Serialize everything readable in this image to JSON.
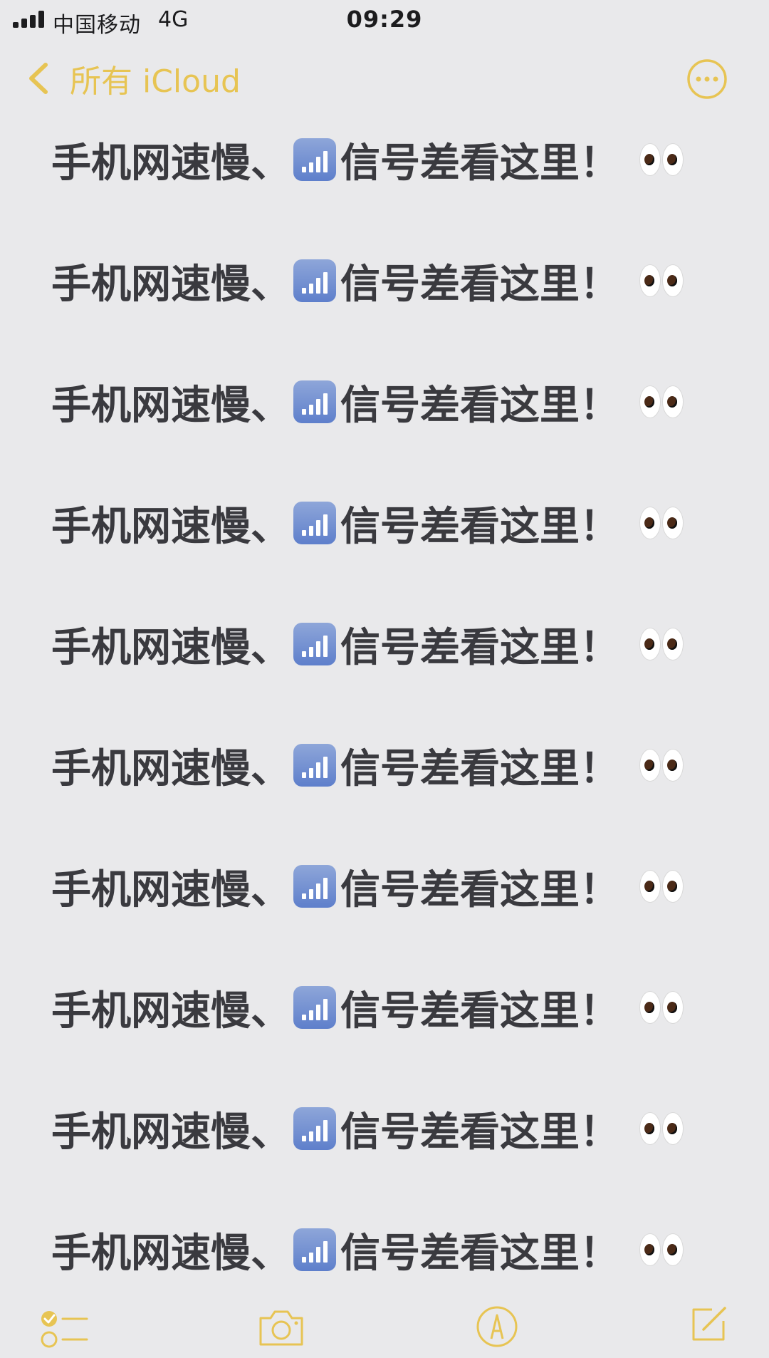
{
  "status_bar": {
    "carrier": "中国移动",
    "network": "4G",
    "time": "09:29"
  },
  "nav": {
    "back_label": "所有 iCloud",
    "icons": {
      "back": "chevron-left-icon",
      "more": "ellipsis-circle-icon"
    }
  },
  "note": {
    "lines": [
      {
        "before": "手机网速慢、",
        "after": "信号差看这里！"
      },
      {
        "before": "手机网速慢、",
        "after": "信号差看这里！"
      },
      {
        "before": "手机网速慢、",
        "after": "信号差看这里！"
      },
      {
        "before": "手机网速慢、",
        "after": "信号差看这里！"
      },
      {
        "before": "手机网速慢、",
        "after": "信号差看这里！"
      },
      {
        "before": "手机网速慢、",
        "after": "信号差看这里！"
      },
      {
        "before": "手机网速慢、",
        "after": "信号差看这里！"
      },
      {
        "before": "手机网速慢、",
        "after": "信号差看这里！"
      },
      {
        "before": "手机网速慢、",
        "after": "信号差看这里！"
      },
      {
        "before": "手机网速慢、",
        "after": "信号差看这里！"
      }
    ]
  },
  "toolbar": {
    "icons": [
      "checklist-icon",
      "camera-icon",
      "markup-icon",
      "compose-icon"
    ]
  },
  "colors": {
    "accent": "#e7c453",
    "text": "#3a3a3f",
    "background": "#e9e9eb"
  }
}
